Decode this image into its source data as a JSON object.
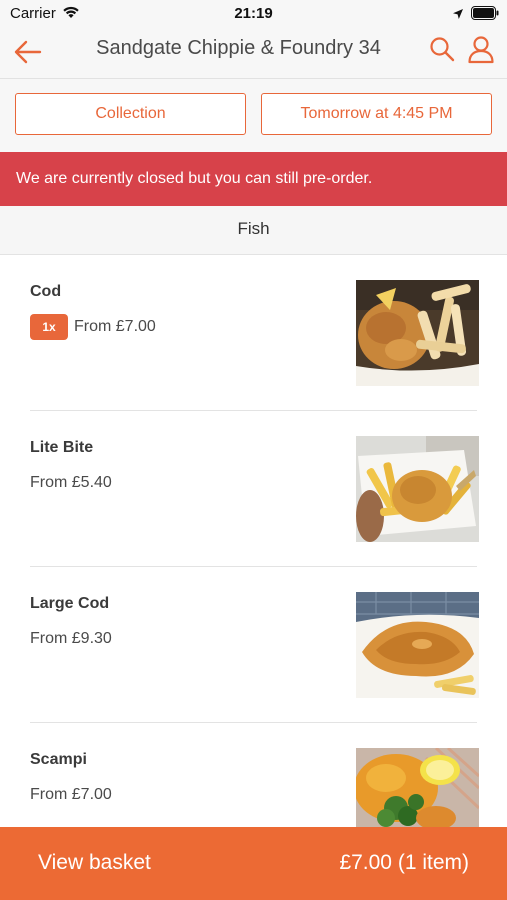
{
  "status_bar": {
    "carrier": "Carrier",
    "time": "21:19"
  },
  "nav": {
    "title": "Sandgate Chippie & Foundry 34",
    "accent_color": "#e8673a"
  },
  "options": {
    "collection_label": "Collection",
    "time_label": "Tomorrow at 4:45 PM"
  },
  "banner": {
    "text": "We are currently closed but you can still pre-order.",
    "color": "#d7424a"
  },
  "category": {
    "title": "Fish"
  },
  "items": [
    {
      "name": "Cod",
      "price": "From £7.00",
      "badge": "1x",
      "image": "fish-and-chips-photo"
    },
    {
      "name": "Lite Bite",
      "price": "From £5.40",
      "badge": "",
      "image": "fish-and-chips-tray-photo"
    },
    {
      "name": "Large Cod",
      "price": "From £9.30",
      "badge": "",
      "image": "battered-fish-photo"
    },
    {
      "name": "Scampi",
      "price": "From £7.00",
      "badge": "",
      "image": "scampi-lemon-photo"
    }
  ],
  "basket": {
    "label": "View basket",
    "total": "£7.00 (1 item)",
    "color": "#ec6a34"
  }
}
